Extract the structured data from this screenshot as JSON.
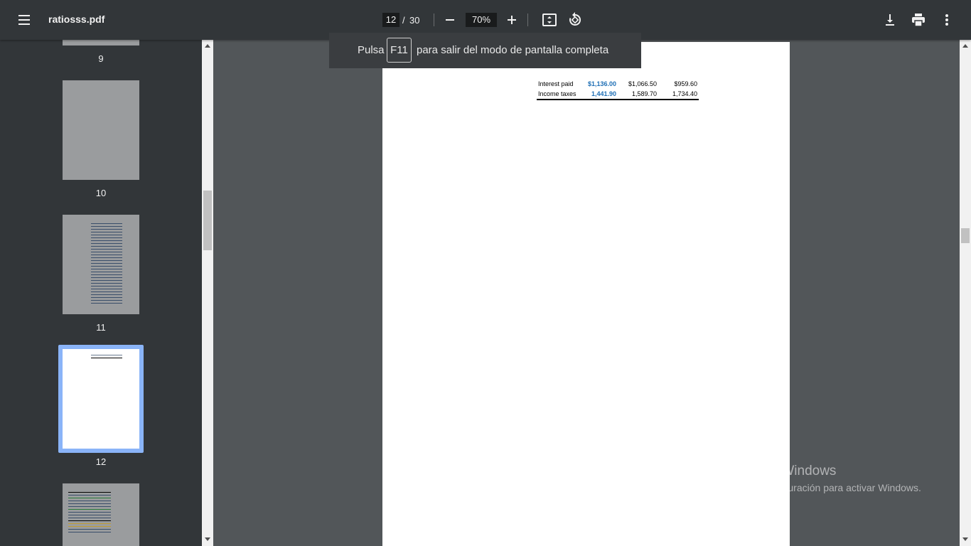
{
  "toolbar": {
    "title": "ratiosss.pdf",
    "current_page": "12",
    "separator": "/",
    "total_pages": "30",
    "zoom": "70%"
  },
  "icons": {
    "menu": "menu-icon",
    "zoom_out": "minus-icon",
    "zoom_in": "plus-icon",
    "fit": "fit-page-icon",
    "rotate": "rotate-icon",
    "download": "download-icon",
    "print": "print-icon",
    "more": "more-vert-icon"
  },
  "toast": {
    "before": "Pulsa",
    "key": "F11",
    "after": "para salir del modo de pantalla completa"
  },
  "sidebar": {
    "thumbnails": [
      {
        "label": "9"
      },
      {
        "label": "10"
      },
      {
        "label": "11"
      },
      {
        "label": "12",
        "selected": true
      },
      {
        "label": ""
      }
    ]
  },
  "document": {
    "table": {
      "rows": [
        {
          "label": "Interest paid",
          "v1": "$1,136.00",
          "v2": "$1,066.50",
          "v3": "$959.60"
        },
        {
          "label": "Income taxes",
          "v1": "1,441.90",
          "v2": "1,589.70",
          "v3": "1,734.40"
        }
      ]
    }
  },
  "watermark": {
    "title": "Activar Windows",
    "subtitle": "Ve a Configuración para activar Windows."
  },
  "colors": {
    "toolbar": "#323639",
    "viewer": "#525659",
    "selection": "#8ab4f8",
    "highlight_value": "#1f6fb5"
  }
}
